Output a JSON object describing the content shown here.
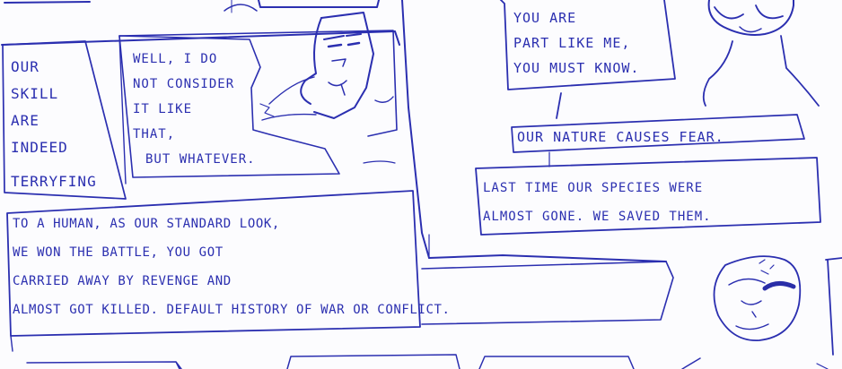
{
  "bubble_skill": {
    "lines": [
      "Our",
      "skill",
      "are",
      "indeed",
      "terryfing"
    ]
  },
  "bubble_well": {
    "lines": [
      "Well, I do",
      "not consider",
      "it like",
      "that,",
      "but whatever."
    ]
  },
  "bubble_part": {
    "lines": [
      "You are",
      "part like me,",
      "you must know."
    ]
  },
  "caption_nature": "Our nature causes fear.",
  "caption_last": {
    "lines": [
      "Last time our species were",
      "almost gone. We saved them."
    ]
  },
  "caption_human": {
    "lines": [
      "To a human, as our standard look,",
      "we won the battle, you got",
      "carried away by revenge and",
      "almost got killed. Default history of war or conflict."
    ]
  },
  "colors": {
    "ink": "#2b2fb0",
    "paper": "#fcfcfe"
  }
}
